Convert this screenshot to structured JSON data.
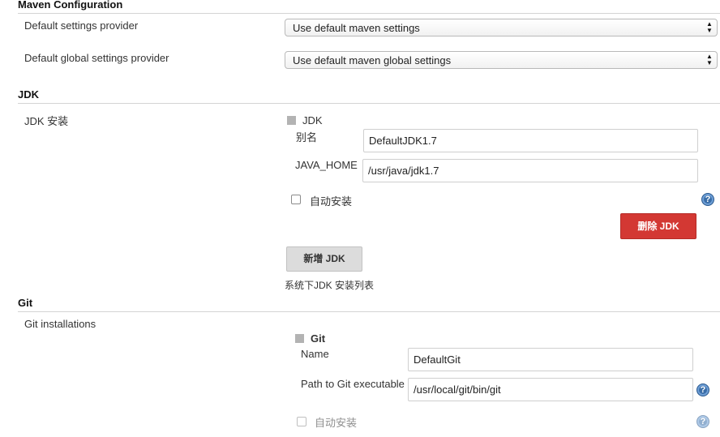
{
  "maven": {
    "header": "Maven Configuration",
    "settings_label": "Default settings provider",
    "settings_value": "Use default maven settings",
    "global_label": "Default global settings provider",
    "global_value": "Use default maven global settings"
  },
  "jdk": {
    "header": "JDK",
    "install_label": "JDK 安装",
    "item_title": "JDK",
    "name_label": "别名",
    "name_value": "DefaultJDK1.7",
    "home_label": "JAVA_HOME",
    "home_value": "/usr/java/jdk1.7",
    "auto_install_label": "自动安装",
    "delete_button": "删除 JDK",
    "add_button": "新增 JDK",
    "list_caption": "系统下JDK 安装列表"
  },
  "git": {
    "header": "Git",
    "install_label": "Git installations",
    "item_title": "Git",
    "name_label": "Name",
    "name_value": "DefaultGit",
    "path_label": "Path to Git executable",
    "path_value": "/usr/local/git/bin/git",
    "auto_install_label": "自动安装"
  },
  "icons": {
    "help": "?",
    "select_arrows_up": "▲",
    "select_arrows_down": "▼"
  },
  "colors": {
    "danger": "#d33833",
    "help": "#3a6ea8"
  }
}
